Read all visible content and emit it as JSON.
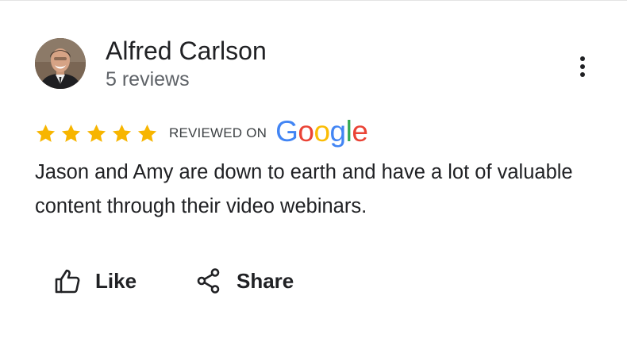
{
  "review": {
    "reviewer_name": "Alfred Carlson",
    "review_count": "5 reviews",
    "rating": 5,
    "rating_max": 5,
    "reviewed_on_label": "REVIEWED ON",
    "platform_logo_letters": [
      "G",
      "o",
      "o",
      "g",
      "l",
      "e"
    ],
    "text": "Jason and Amy are down to earth and have a lot of valuable content through their video webinars."
  },
  "actions": {
    "like_label": "Like",
    "share_label": "Share"
  },
  "icons": {
    "more": "more-vert-icon",
    "like": "thumbs-up-icon",
    "share": "share-icon",
    "star": "star-icon"
  },
  "colors": {
    "star": "#f7b500",
    "text": "#202124",
    "muted": "#5f6368",
    "google_blue": "#4285f4",
    "google_red": "#ea4335",
    "google_yellow": "#fbbc05",
    "google_green": "#34a853"
  }
}
